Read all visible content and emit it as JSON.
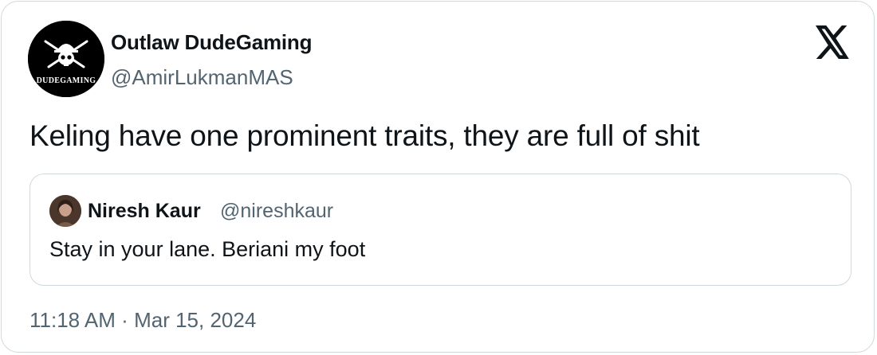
{
  "author": {
    "display_name": "Outlaw DudeGaming",
    "handle": "@AmirLukmanMAS",
    "avatar_text": "DUDEGAMING"
  },
  "tweet": {
    "text": "Keling have one prominent traits, they are full of shit",
    "time": "11:18 AM",
    "separator": "·",
    "date": "Mar 15, 2024"
  },
  "quoted_tweet": {
    "display_name": "Niresh Kaur",
    "handle": "@nireshkaur",
    "text": "Stay in your lane. Beriani my foot"
  },
  "brand": {
    "logo": "x-logo-icon"
  },
  "colors": {
    "text": "#0f1419",
    "secondary": "#536471",
    "border": "#cfd9de",
    "background": "#ffffff"
  }
}
